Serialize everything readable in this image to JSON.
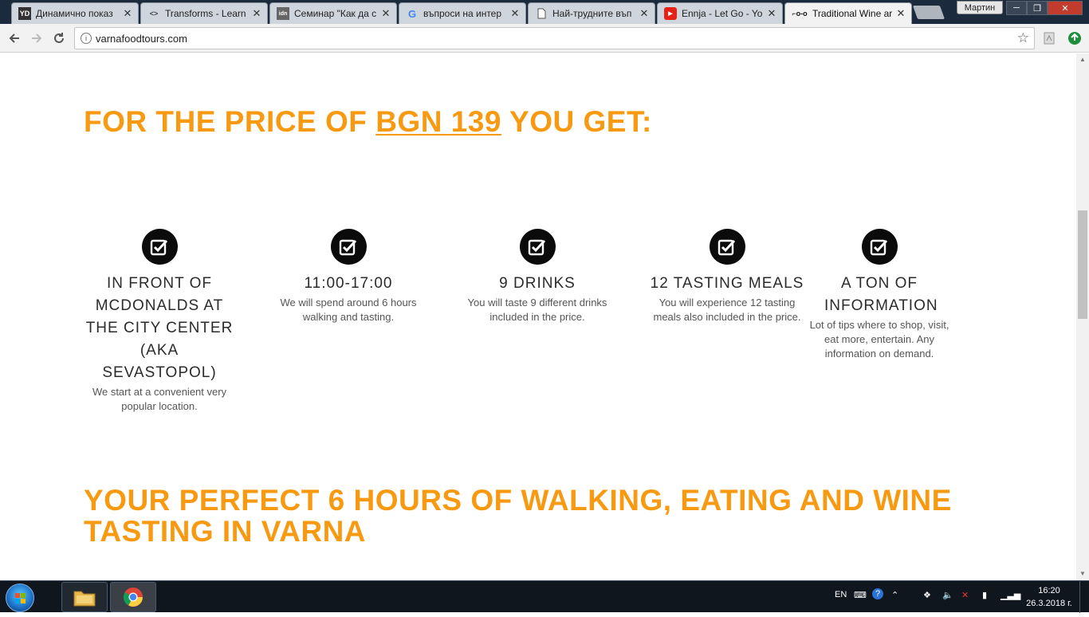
{
  "browser": {
    "tabs": [
      {
        "title": "Динамично показ",
        "favicon_text": "YD",
        "active": false
      },
      {
        "title": "Transforms - Learn",
        "favicon_text": "<>",
        "active": false
      },
      {
        "title": "Семинар \"Как да с",
        "favicon_text": "idn",
        "active": false
      },
      {
        "title": "въпроси на интер",
        "favicon_text": "G",
        "active": false
      },
      {
        "title": "Най-трудните въп",
        "favicon_text": "",
        "active": false
      },
      {
        "title": "Ennja - Let Go - Yo",
        "favicon_text": "▶",
        "active": false
      },
      {
        "title": "Traditional Wine ar",
        "favicon_text": "⌐o-o",
        "active": true
      }
    ],
    "user": "Мартин",
    "url": "varnafoodtours.com"
  },
  "page": {
    "heading_prefix": "FOR THE PRICE OF ",
    "heading_price": "BGN 139",
    "heading_suffix": " YOU GET:",
    "features": [
      {
        "title": "IN FRONT OF MCDONALDS AT THE CITY CENTER (AKA SEVASTOPOL)",
        "description": "We start at a convenient very popular location."
      },
      {
        "title": "11:00-17:00",
        "description": "We will spend around 6 hours walking and tasting."
      },
      {
        "title": "9 DRINKS",
        "description": "You will taste 9 different drinks included in the price."
      },
      {
        "title": "12 TASTING MEALS",
        "description": "You will experience 12 tasting meals also included in the price."
      },
      {
        "title": "A TON OF INFORMATION",
        "description": "Lot of tips where to shop, visit, eat more, entertain. Any information on demand."
      }
    ],
    "heading2": "YOUR PERFECT 6 HOURS OF WALKING, EATING AND WINE TASTING IN VARNA"
  },
  "taskbar": {
    "language": "EN",
    "time": "16:20",
    "date": "26.3.2018 г."
  },
  "colors": {
    "accent": "#f79a12",
    "feature_badge": "#0b0b0b",
    "tabstrip": "#1c2a3d"
  }
}
